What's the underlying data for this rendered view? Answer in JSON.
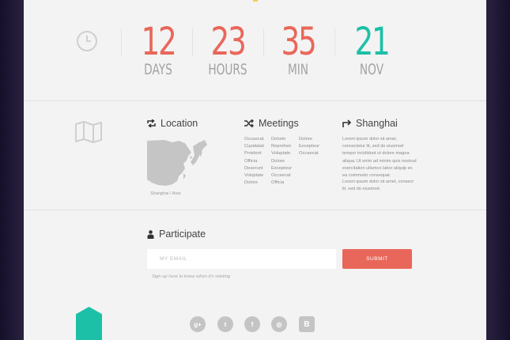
{
  "colors": {
    "accent_red": "#e9675a",
    "accent_teal": "#1cc0a7",
    "background": "#f3f3f3",
    "frame": "#1e1733"
  },
  "countdown": [
    {
      "value": "12",
      "unit": "DAYS",
      "color": "#e9675a"
    },
    {
      "value": "23",
      "unit": "HOURS",
      "color": "#e9675a"
    },
    {
      "value": "35",
      "unit": "MIN",
      "color": "#e9675a"
    },
    {
      "value": "21",
      "unit": "NOV",
      "color": "#1cc0a7"
    }
  ],
  "icons": {
    "countdown": "clock-icon",
    "info": "map-icon",
    "location": "repeat-icon",
    "meetings": "shuffle-icon",
    "city": "return-arrow-icon",
    "participate": "person-icon"
  },
  "location": {
    "title": "Location",
    "caption": "Shanghai / Asia"
  },
  "meetings": {
    "title": "Meetings",
    "columns": [
      [
        "Occaecat",
        "Cupidatat",
        "Proident",
        "Officia",
        "Deserunt",
        "Voluptate",
        "Dolore"
      ],
      [
        "Dolorin",
        "Reprehen",
        "Voluptate",
        "Dolore",
        "Excepteur",
        "Occaecat",
        "Officia"
      ],
      [
        "Dolore",
        "Excepteur",
        "Occaecat"
      ]
    ]
  },
  "shanghai": {
    "title": "Shanghai",
    "para1": "Lorem ipsum dolor sit amet, consectetur lit, sed do eiusmod tempor incididunt ut dolore magna aliqua. Ut enim ad minim quis nostrud exercitation ullamco labor aliquip ex ea commodo consequat.",
    "para2": "Lorem ipsum dolor sit amet, consect lit, sed do eiusmod."
  },
  "participate": {
    "title": "Participate",
    "email_placeholder": "MY EMAIL",
    "email_value": "",
    "submit_label": "SUBMIT",
    "hint": "Sign up here to know when it's starting"
  },
  "social": [
    {
      "name": "google-plus-icon",
      "glyph": "g+"
    },
    {
      "name": "twitter-icon",
      "glyph": "t"
    },
    {
      "name": "facebook-icon",
      "glyph": "f"
    },
    {
      "name": "dribbble-icon",
      "glyph": "◎"
    },
    {
      "name": "behance-icon",
      "glyph": "B"
    }
  ]
}
